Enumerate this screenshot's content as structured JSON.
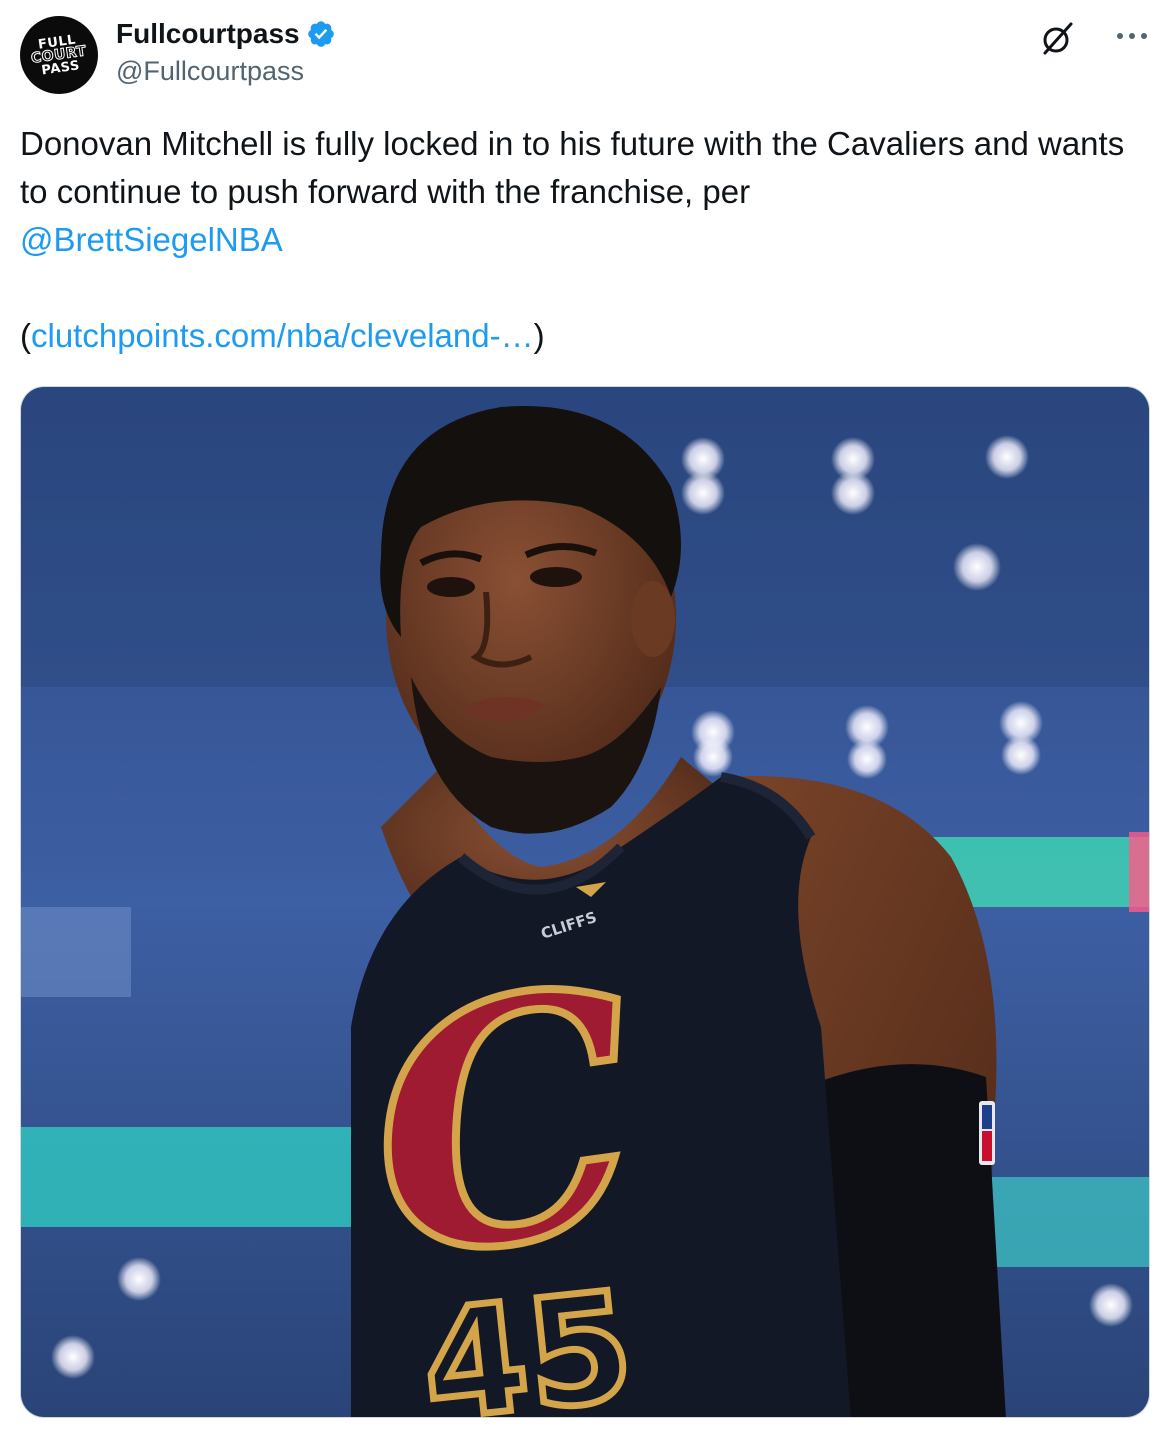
{
  "account": {
    "display_name": "Fullcourtpass",
    "handle": "@Fullcourtpass",
    "verified": true,
    "avatar_logo_lines": [
      "FULL",
      "COURT",
      "PASS"
    ]
  },
  "post": {
    "text_main": "Donovan Mitchell is fully locked in to his future with the Cavaliers and wants to continue to push forward with the franchise, per",
    "mention": "@BrettSiegelNBA",
    "paren_open": "(",
    "link": "clutchpoints.com/nba/cleveland-…",
    "paren_close": ")"
  },
  "media": {
    "jersey_sponsor": "CLIFFS",
    "jersey_number": "45",
    "jersey_logo_letter": "C"
  },
  "icons": {
    "grok": "grok-icon",
    "more": "more-options-icon",
    "verified": "verified-badge-icon"
  },
  "colors": {
    "link": "#1d9bf0",
    "text": "#0f1419",
    "secondary": "#536471",
    "verified": "#1d9bf0",
    "jersey_gold": "#d4a44a",
    "jersey_wine": "#9e1b32",
    "jersey_navy": "#121826"
  }
}
